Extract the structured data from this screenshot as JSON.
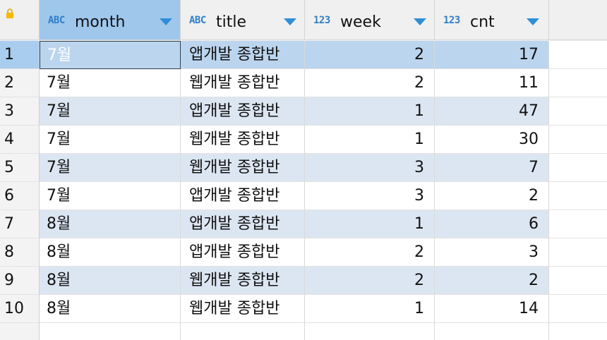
{
  "columns": [
    {
      "type_icon": "ABC",
      "name": "month"
    },
    {
      "type_icon": "ABC",
      "name": "title"
    },
    {
      "type_icon": "123",
      "name": "week"
    },
    {
      "type_icon": "123",
      "name": "cnt"
    }
  ],
  "rows": [
    {
      "num": "1",
      "month": "7월",
      "title": "앱개발 종합반",
      "week": "2",
      "cnt": "17"
    },
    {
      "num": "2",
      "month": "7월",
      "title": "웹개발 종합반",
      "week": "2",
      "cnt": "11"
    },
    {
      "num": "3",
      "month": "7월",
      "title": "앱개발 종합반",
      "week": "1",
      "cnt": "47"
    },
    {
      "num": "4",
      "month": "7월",
      "title": "웹개발 종합반",
      "week": "1",
      "cnt": "30"
    },
    {
      "num": "5",
      "month": "7월",
      "title": "웹개발 종합반",
      "week": "3",
      "cnt": "7"
    },
    {
      "num": "6",
      "month": "7월",
      "title": "앱개발 종합반",
      "week": "3",
      "cnt": "2"
    },
    {
      "num": "7",
      "month": "8월",
      "title": "앱개발 종합반",
      "week": "1",
      "cnt": "6"
    },
    {
      "num": "8",
      "month": "8월",
      "title": "앱개발 종합반",
      "week": "2",
      "cnt": "3"
    },
    {
      "num": "9",
      "month": "8월",
      "title": "웹개발 종합반",
      "week": "2",
      "cnt": "2"
    },
    {
      "num": "10",
      "month": "8월",
      "title": "웹개발 종합반",
      "week": "1",
      "cnt": "14"
    }
  ],
  "icons": {
    "corner": "lock-icon",
    "sort": "chevron-down-icon"
  },
  "colors": {
    "selected_cell": "#6aaae3",
    "selected_row": "#bcd5ee",
    "alt_row": "#dce6f2",
    "type_icon": "#2f7fc8",
    "sort_arrow": "#2f8fd6"
  }
}
